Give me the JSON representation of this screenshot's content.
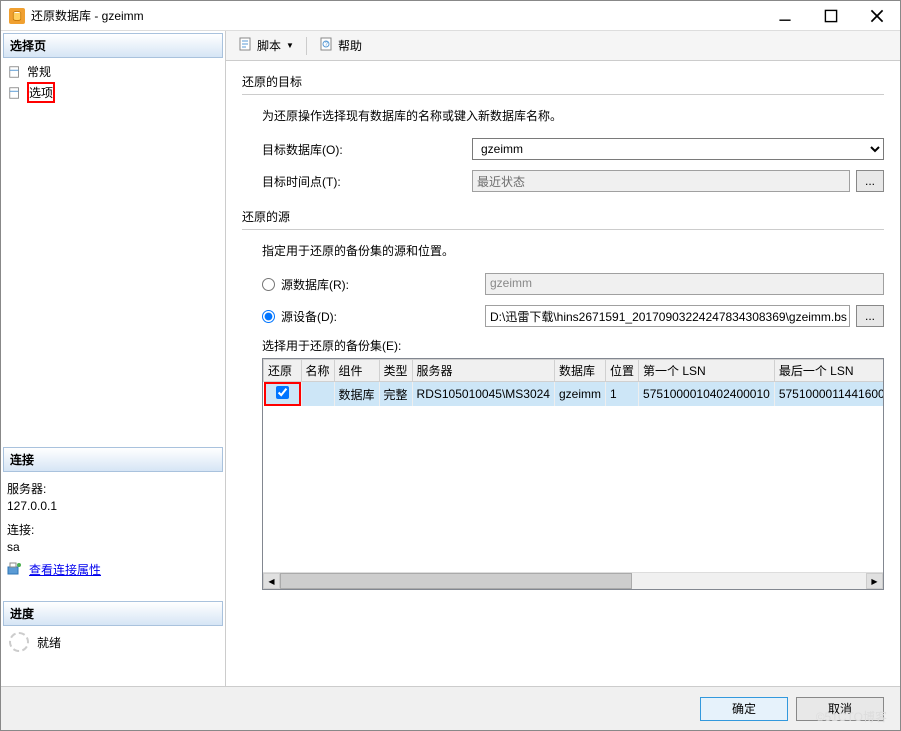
{
  "window": {
    "title": "还原数据库 - gzeimm"
  },
  "toolbar": {
    "script": "脚本",
    "help": "帮助"
  },
  "sidebar": {
    "select_page": "选择页",
    "items": [
      {
        "label": "常规"
      },
      {
        "label": "选项"
      }
    ],
    "connection_header": "连接",
    "server_label": "服务器:",
    "server_value": "127.0.0.1",
    "conn_label": "连接:",
    "conn_value": "sa",
    "view_conn": "查看连接属性",
    "progress_header": "进度",
    "progress_status": "就绪"
  },
  "target": {
    "group": "还原的目标",
    "desc": "为还原操作选择现有数据库的名称或键入新数据库名称。",
    "db_label": "目标数据库(O):",
    "db_value": "gzeimm",
    "time_label": "目标时间点(T):",
    "time_value": "最近状态"
  },
  "source": {
    "group": "还原的源",
    "desc": "指定用于还原的备份集的源和位置。",
    "src_db_label": "源数据库(R):",
    "src_db_value": "gzeimm",
    "src_dev_label": "源设备(D):",
    "src_dev_value": "D:\\迅雷下载\\hins2671591_20170903224247834308369\\gzeimm.bs",
    "sets_label": "选择用于还原的备份集(E):"
  },
  "table": {
    "headers": {
      "restore": "还原",
      "name": "名称",
      "component": "组件",
      "type": "类型",
      "server": "服务器",
      "database": "数据库",
      "position": "位置",
      "first_lsn": "第一个 LSN",
      "last_lsn": "最后一个 LSN"
    },
    "row": {
      "component": "数据库",
      "type": "完整",
      "server": "RDS105010045\\MS3024",
      "database": "gzeimm",
      "position": "1",
      "first_lsn": "5751000010402400010",
      "last_lsn": "5751000011441600"
    }
  },
  "buttons": {
    "ok": "确定",
    "cancel": "取消",
    "ellipsis": "..."
  },
  "watermark": "©51CTO博客"
}
